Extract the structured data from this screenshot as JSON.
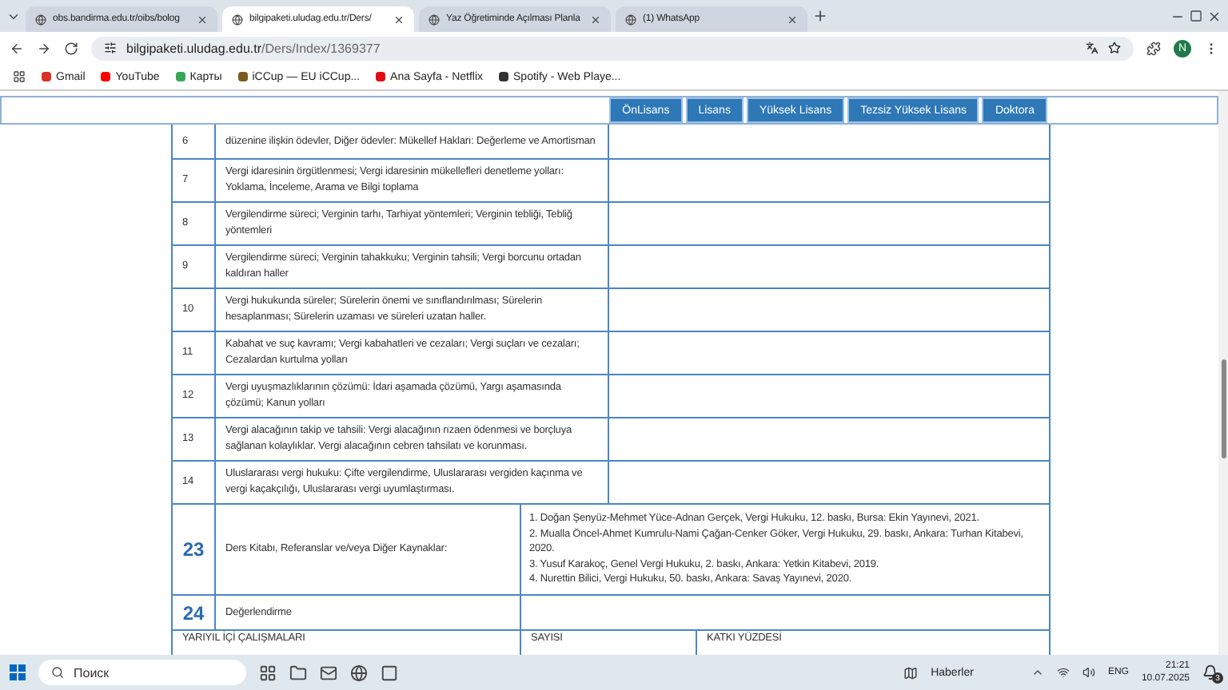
{
  "browser": {
    "tabs": [
      {
        "title": "obs.bandirma.edu.tr/oibs/bolog",
        "selected": false
      },
      {
        "title": "bilgipaketi.uludag.edu.tr/Ders/",
        "selected": true
      },
      {
        "title": "Yaz Öğretiminde Açılması Planla",
        "selected": false
      },
      {
        "title": "(1) WhatsApp",
        "selected": false
      }
    ],
    "address": {
      "host": "bilgipaketi.uludag.edu.tr",
      "path": "/Ders/Index/1369377"
    },
    "profile": "N",
    "bookmarks": [
      "Gmail",
      "YouTube",
      "Карты",
      "iCCup — EU iCCup...",
      "Ana Sayfa - Netflix",
      "Spotify - Web Playe..."
    ]
  },
  "page": {
    "nav_buttons": [
      "ÖnLisans",
      "Lisans",
      "Yüksek Lisans",
      "Tezsiz Yüksek Lisans",
      "Doktora"
    ],
    "topics": [
      {
        "number": "6",
        "text": "düzenine ilişkin ödevler, Diğer ödevler: Mükellef Hakları: Değerleme ve Amortisman"
      },
      {
        "number": "7",
        "text": "Vergi idaresinin örgütlenmesi; Vergi idaresinin mükellefleri denetleme yolları: Yoklama, İnceleme, Arama ve Bilgi toplama"
      },
      {
        "number": "8",
        "text": "Vergilendirme süreci; Verginin tarhı, Tarhiyat yöntemleri; Verginin tebliği, Tebliğ yöntemleri"
      },
      {
        "number": "9",
        "text": "Vergilendirme süreci; Verginin tahakkuku; Verginin tahsili; Vergi borcunu ortadan kaldıran haller"
      },
      {
        "number": "10",
        "text": "Vergi hukukunda süreler; Sürelerin önemi ve sınıflandırılması; Sürelerin hesaplanması; Sürelerin uzaması ve süreleri uzatan haller."
      },
      {
        "number": "11",
        "text": "Kabahat ve suç kavramı; Vergi kabahatleri ve cezaları; Vergi suçları ve cezaları; Cezalardan kurtulma yolları"
      },
      {
        "number": "12",
        "text": "Vergi uyuşmazlıklarının çözümü: İdari aşamada çözümü, Yargı aşamasında çözümü; Kanun yolları"
      },
      {
        "number": "13",
        "text": "Vergi alacağının takip ve tahsili: Vergi alacağının rızaen ödenmesi ve borçluya sağlanan kolaylıklar. Vergi alacağının cebren tahsilatı ve korunması."
      },
      {
        "number": "14",
        "text": "Uluslararası vergi hukuku: Çifte vergilendirme, Uluslararası vergiden kaçınma ve vergi kaçakçılığı, Uluslararası vergi uyumlaştırması."
      }
    ],
    "sections": [
      {
        "number": "23",
        "label": "Ders Kitabı, Referanslar ve/veya Diğer Kaynaklar:",
        "lines": [
          "1. Doğan Şenyüz-Mehmet Yüce-Adnan Gerçek, Vergi Hukuku, 12. baskı, Bursa: Ekin Yayınevi, 2021.",
          "2. Mualla Öncel-Ahmet Kumrulu-Nami Çağan-Cenker Göker, Vergi Hukuku, 29. baskı, Ankara: Turhan Kitabevi, 2020.",
          "3. Yusuf Karakoç, Genel Vergi Hukuku, 2. baskı, Ankara: Yetkin Kitabevi, 2019.",
          "4. Nurettin Bilici, Vergi Hukuku, 50. baskı, Ankara: Savaş Yayınevi, 2020."
        ]
      },
      {
        "number": "24",
        "label": "Değerlendirme"
      }
    ],
    "grading_header": [
      "YARIYIL İÇİ ÇALIŞMALARI",
      "SAYISI",
      "KATKI YÜZDESİ"
    ]
  },
  "taskbar": {
    "search_placeholder": "Поиск",
    "news": "Haberler",
    "language": "ENG",
    "time": "21:21",
    "date": "10.07.2025",
    "notification_count": "3"
  }
}
